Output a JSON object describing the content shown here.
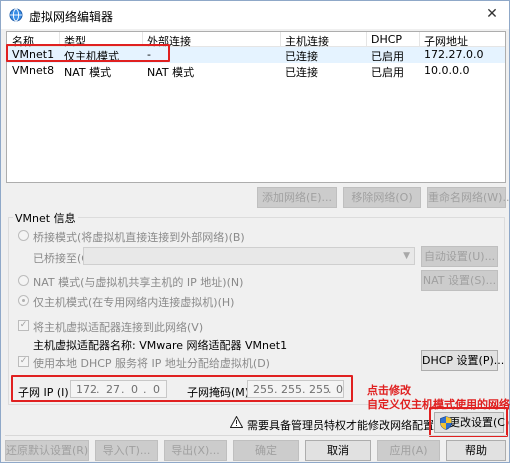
{
  "window": {
    "title": "虚拟网络编辑器",
    "close_glyph": "✕"
  },
  "list": {
    "columns": [
      "名称",
      "类型",
      "外部连接",
      "主机连接",
      "DHCP",
      "子网地址"
    ],
    "rows": [
      {
        "name": "VMnet1",
        "type": "仅主机模式",
        "external": "-",
        "host": "已连接",
        "dhcp": "已启用",
        "subnet": "172.27.0.0"
      },
      {
        "name": "VMnet8",
        "type": "NAT 模式",
        "external": "NAT 模式",
        "host": "已连接",
        "dhcp": "已启用",
        "subnet": "10.0.0.0"
      }
    ]
  },
  "list_buttons": {
    "add": "添加网络(E)...",
    "remove": "移除网络(O)",
    "rename": "重命名网络(W)..."
  },
  "vmnet_info": {
    "label": "VMnet 信息",
    "bridge": "桥接模式(将虚拟机直接连接到外部网络)(B)",
    "bridged_to": "已桥接至(G):",
    "auto_btn": "自动设置(U)...",
    "nat": "NAT 模式(与虚拟机共享主机的 IP 地址)(N)",
    "nat_btn": "NAT 设置(S)...",
    "hostonly": "仅主机模式(在专用网络内连接虚拟机)(H)",
    "connect_adapter": "将主机虚拟适配器连接到此网络(V)",
    "adapter_name": "主机虚拟适配器名称: VMware 网络适配器 VMnet1",
    "use_dhcp": "使用本地 DHCP 服务将 IP 地址分配给虚拟机(D)",
    "dhcp_btn": "DHCP 设置(P)...",
    "subnet_ip_label": "子网 IP (I):",
    "subnet_ip": [
      "172",
      "27",
      "0",
      "0"
    ],
    "subnet_mask_label": "子网掩码(M):",
    "subnet_mask": [
      "255",
      "255",
      "255",
      "0"
    ],
    "ip_dot": "."
  },
  "annotation": {
    "line1": "点击修改",
    "line2": "自定义仅主机模式使用的网络"
  },
  "admin_notice": "需要具备管理员特权才能修改网络配置。",
  "change_settings_btn": "更改设置(C)",
  "bottom_buttons": {
    "restore": "还原默认设置(R)",
    "import": "导入(T)...",
    "export": "导出(X)...",
    "ok": "确定",
    "cancel": "取消",
    "apply": "应用(A)",
    "help": "帮助"
  }
}
